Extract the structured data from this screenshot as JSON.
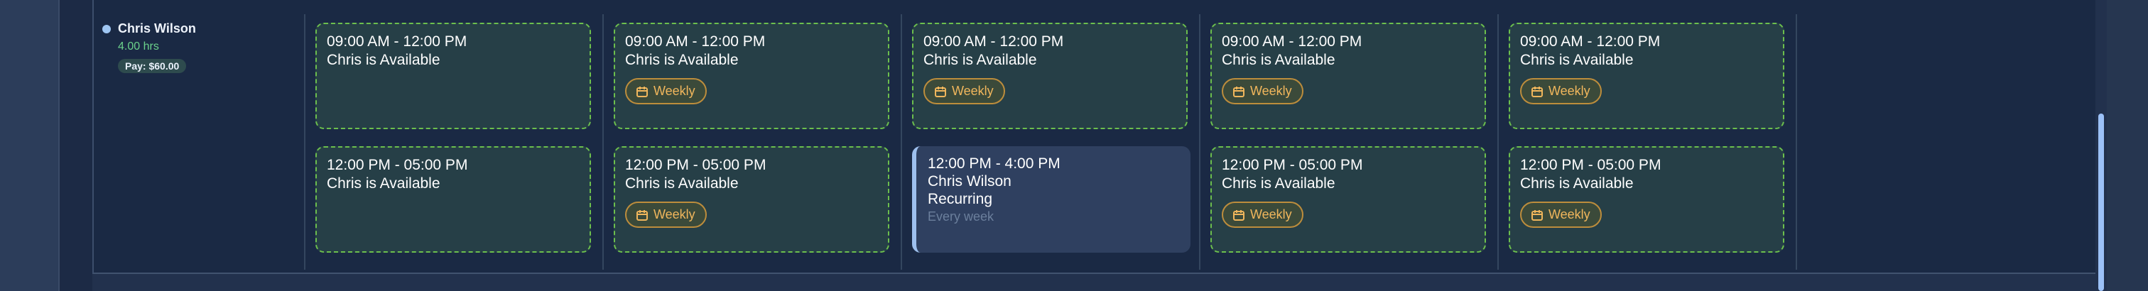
{
  "staff": {
    "name": "Chris Wilson",
    "hours": "4.00 hrs",
    "pay": "Pay: $60.00"
  },
  "badge_label": "Weekly",
  "availability": [
    {
      "time": "09:00 AM - 12:00 PM",
      "label": "Chris is Available",
      "badge": false
    },
    {
      "time": "12:00 PM - 05:00 PM",
      "label": "Chris is Available",
      "badge": false
    },
    {
      "time": "09:00 AM - 12:00 PM",
      "label": "Chris is Available",
      "badge": true
    },
    {
      "time": "12:00 PM - 05:00 PM",
      "label": "Chris is Available",
      "badge": true
    },
    {
      "time": "09:00 AM - 12:00 PM",
      "label": "Chris is Available",
      "badge": true
    },
    {
      "time": "09:00 AM - 12:00 PM",
      "label": "Chris is Available",
      "badge": true
    },
    {
      "time": "12:00 PM - 05:00 PM",
      "label": "Chris is Available",
      "badge": true
    },
    {
      "time": "09:00 AM - 12:00 PM",
      "label": "Chris is Available",
      "badge": true
    },
    {
      "time": "12:00 PM - 05:00 PM",
      "label": "Chris is Available",
      "badge": true
    }
  ],
  "shift": {
    "time": "12:00 PM - 4:00 PM",
    "staff": "Chris Wilson",
    "type": "Recurring",
    "recurrence": "Every week"
  },
  "colors": {
    "available_border": "#6cbf4d",
    "badge": "#f0b65c",
    "hours": "#6bd18b",
    "shift_accent": "#9ec0ee"
  }
}
